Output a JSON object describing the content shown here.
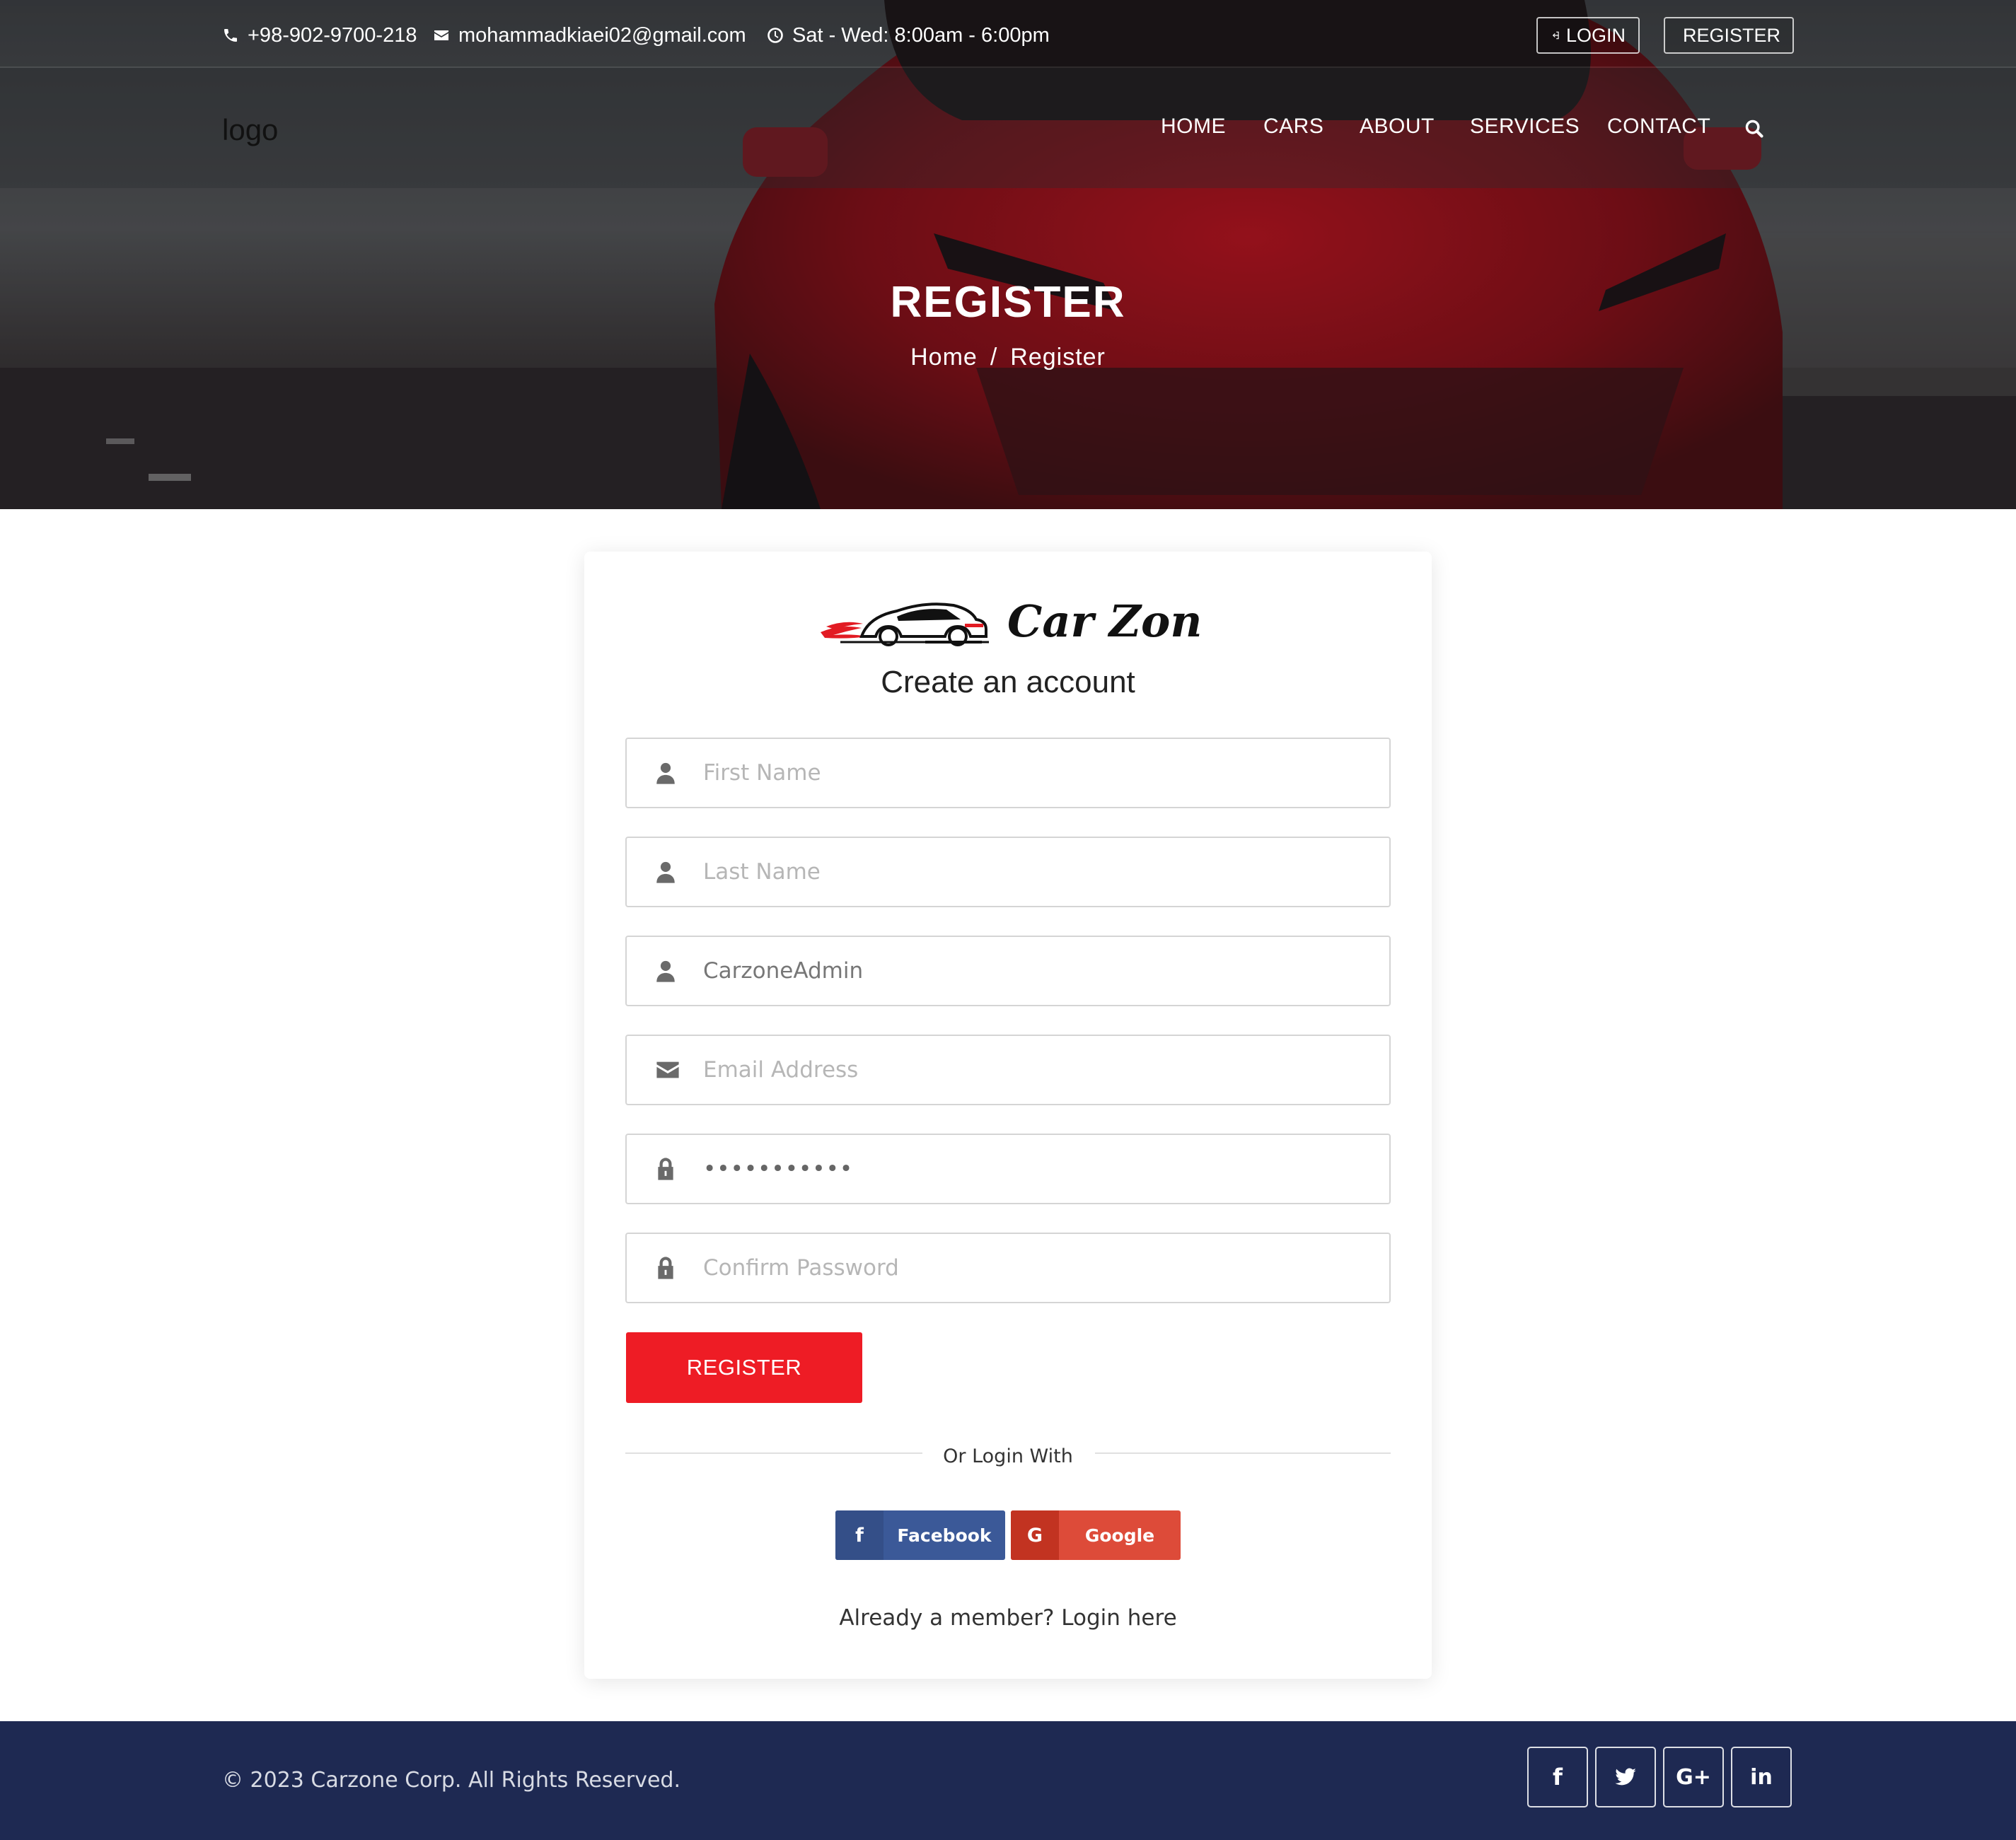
{
  "topbar": {
    "phone": "+98-902-9700-218",
    "email": "mohammadkiaei02@gmail.com",
    "hours": "Sat - Wed: 8:00am - 6:00pm",
    "login_label": "LOGIN",
    "register_label": "REGISTER"
  },
  "navbar": {
    "logo": "logo",
    "items": [
      "HOME",
      "CARS",
      "ABOUT",
      "SERVICES",
      "CONTACT"
    ]
  },
  "hero": {
    "title": "REGISTER",
    "breadcrumb_home": "Home",
    "breadcrumb_sep": "/",
    "breadcrumb_current": "Register"
  },
  "form": {
    "brand_name": "Car Zone",
    "title": "Create an account",
    "first_name_placeholder": "First Name",
    "last_name_placeholder": "Last Name",
    "username_value": "CarzoneAdmin",
    "email_placeholder": "Email Address",
    "password_value": "•••••••••••",
    "confirm_placeholder": "Confirm Password",
    "submit_label": "REGISTER",
    "or_text": "Or Login With",
    "facebook_label": "Facebook",
    "google_label": "Google",
    "member_text": "Already a member?  Login here"
  },
  "footer": {
    "copyright": "© 2023 Carzone Corp. All Rights Reserved.",
    "social": [
      "facebook-icon",
      "twitter-icon",
      "google-plus-icon",
      "linkedin-icon"
    ]
  },
  "colors": {
    "accent_red": "#ee1c25",
    "footer_navy": "#1e2952",
    "facebook": "#3b5998",
    "google": "#dd4b39"
  }
}
